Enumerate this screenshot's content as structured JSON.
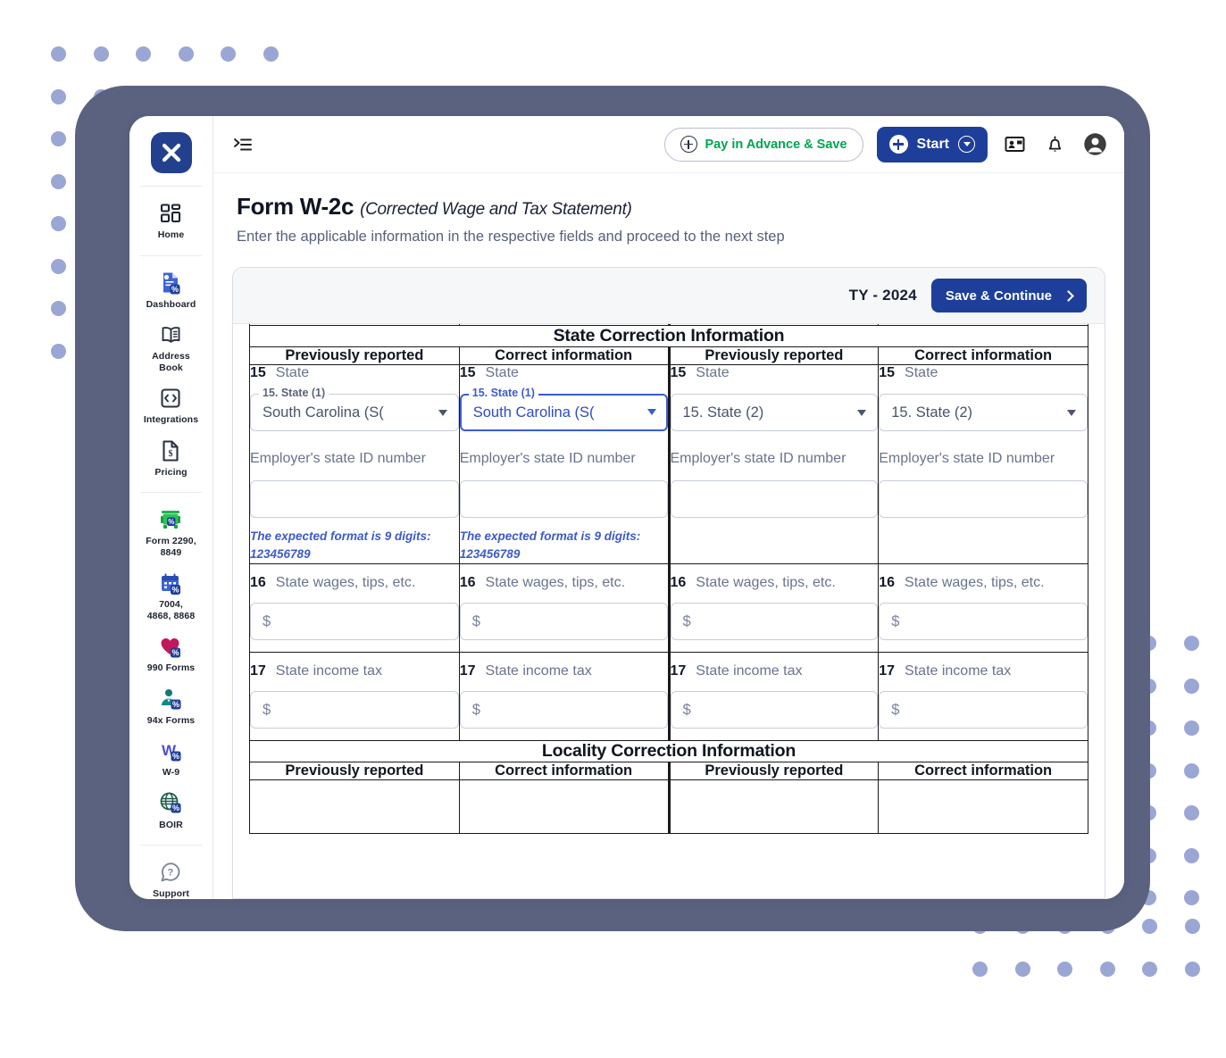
{
  "brand": {
    "logo_text": "✘",
    "logo_color": "#23408e"
  },
  "sidebar": {
    "groups": [
      {
        "items": [
          {
            "label": "Home",
            "icon": "grid-icon"
          }
        ]
      },
      {
        "items": [
          {
            "label": "Dashboard",
            "icon": "document-percent-icon"
          },
          {
            "label": "Address\nBook",
            "icon": "address-book-icon"
          },
          {
            "label": "Integrations",
            "icon": "code-brackets-icon"
          },
          {
            "label": "Pricing",
            "icon": "price-tag-icon"
          }
        ]
      },
      {
        "items": [
          {
            "label": "Form 2290,\n8849",
            "icon": "truck-icon"
          },
          {
            "label": "7004,\n4868, 8868",
            "icon": "calendar-percent-icon"
          },
          {
            "label": "990 Forms",
            "icon": "heart-percent-icon"
          },
          {
            "label": "94x Forms",
            "icon": "person-percent-icon"
          },
          {
            "label": "W-9",
            "icon": "w-percent-icon"
          },
          {
            "label": "BOIR",
            "icon": "globe-percent-icon"
          }
        ]
      },
      {
        "items": [
          {
            "label": "Support",
            "icon": "question-mark-icon"
          }
        ]
      }
    ]
  },
  "topbar": {
    "collapse_icon": "collapse-sidebar-icon",
    "pay_in_advance_label": "Pay in Advance & Save",
    "start_label": "Start",
    "contact_icon": "contact-card-icon",
    "bell_icon": "notification-bell-icon",
    "account_icon": "user-account-icon"
  },
  "page": {
    "title": "Form W-2c",
    "title_sub": "(Corrected Wage and Tax Statement)",
    "description": "Enter the applicable information in the respective fields and proceed to the next step"
  },
  "card": {
    "tax_year": "TY - 2024",
    "save_continue_label": "Save & Continue"
  },
  "labels": {
    "previously_reported": "Previously reported",
    "correct_information": "Correct information",
    "state_section": "State Correction Information",
    "locality_section": "Locality Correction Information",
    "state_num": "15",
    "state_label": "State",
    "wages_num": "16",
    "wages_label": "State wages, tips, etc.",
    "income_tax_num": "17",
    "income_tax_label": "State income tax",
    "employer_state_id": "Employer's state ID number",
    "hint_text": "The expected format is 9 digits: 123456789",
    "dollar_placeholder": "$"
  },
  "fields": {
    "state1_legend": "15. State (1)",
    "state1_value": "South Carolina (S(",
    "state2_placeholder": "15. State (2)"
  },
  "decor": {
    "dot_color": "#9aa6d4",
    "frame_color": "#5b6280"
  }
}
